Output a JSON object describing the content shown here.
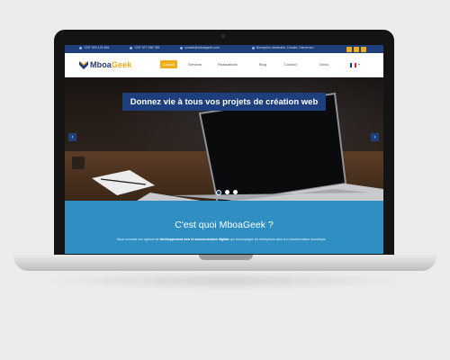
{
  "topbar": {
    "phone1": "+237 699 123 456",
    "phone2": "+237 677 456 789",
    "email": "contact@mboageek.com",
    "address": "Bonapriso Immeuble, Douala, Cameroun",
    "social_icons": [
      "facebook-icon",
      "twitter-icon",
      "linkedin-icon"
    ],
    "colors": {
      "bar": "#1f3f7a",
      "social": "#f0ad1a"
    }
  },
  "nav": {
    "logo_part1": "Mboa",
    "logo_part2": "Geek",
    "items": [
      "Accueil",
      "Services",
      "Réalisations",
      "Blog",
      "Contact",
      "Devis"
    ],
    "active_index": 0,
    "language": "fr"
  },
  "hero": {
    "headline": "Donnez vie à tous vos projets de création web",
    "prev_icon": "chevron-left-icon",
    "next_icon": "chevron-right-icon",
    "slides_total": 3,
    "slide_active": 1
  },
  "about": {
    "title": "C'est quoi MboaGeek ?",
    "text_before": "Nous sommes une agence de ",
    "text_bold": "développement web et communication digitale",
    "text_after": " qui accompagne les entreprises dans leur transformation numérique"
  },
  "colors": {
    "brand_blue": "#1e3b73",
    "accent": "#f0ad1a",
    "section_blue": "#2f8fc3"
  }
}
